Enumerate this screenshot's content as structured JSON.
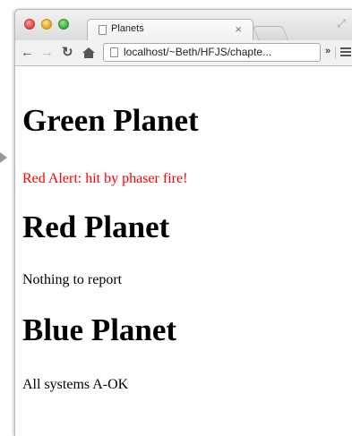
{
  "browser": {
    "tab_title": "Planets",
    "tab_close": "×",
    "address": "localhost/~Beth/HFJS/chapte...",
    "overflow": "»",
    "nav_icons": {
      "back": "back-arrow-icon",
      "forward": "forward-arrow-icon",
      "reload": "reload-icon",
      "home": "home-icon",
      "menu": "hamburger-menu-icon"
    }
  },
  "colors": {
    "alert": "#ff0000",
    "heading": "#000000"
  },
  "planets": [
    {
      "heading": "Green Planet",
      "status": "Red Alert: hit by phaser fire!",
      "status_color": "#ff0000"
    },
    {
      "heading": "Red Planet",
      "status": "Nothing to report",
      "status_color": "#000000"
    },
    {
      "heading": "Blue Planet",
      "status": "All systems A-OK",
      "status_color": "#000000"
    }
  ]
}
